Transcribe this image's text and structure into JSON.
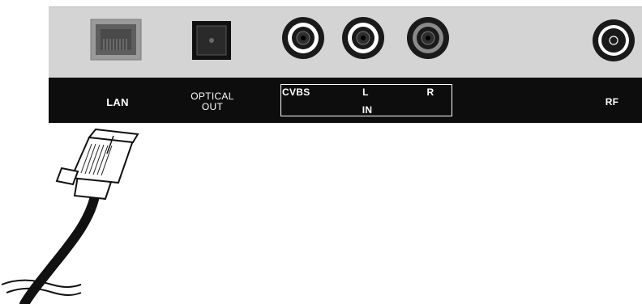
{
  "labels": {
    "lan": "LAN",
    "optical_out": "OPTICAL\nOUT",
    "cvbs": "CVBS",
    "left": "L",
    "right": "R",
    "in": "IN",
    "rf": "RF"
  }
}
